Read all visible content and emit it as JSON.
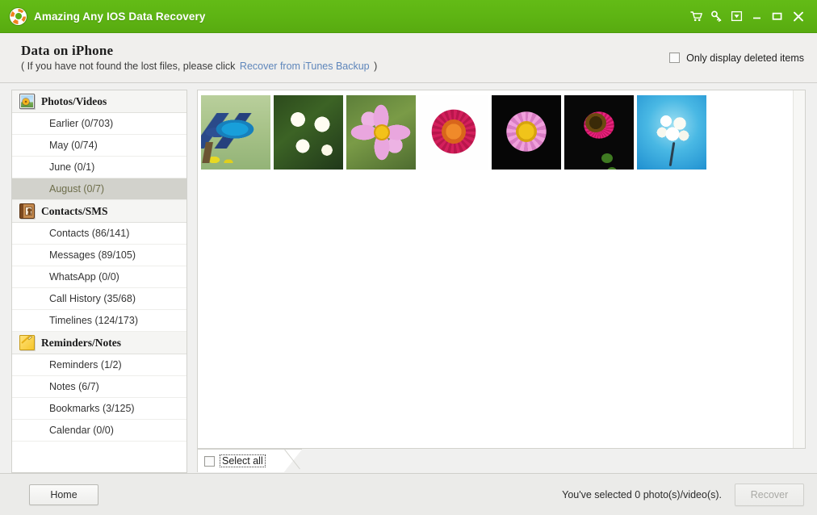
{
  "titlebar": {
    "app_title": "Amazing Any IOS Data Recovery",
    "logo_icon": "lifebuoy-icon",
    "controls": [
      {
        "name": "cart-icon",
        "label": "Buy"
      },
      {
        "name": "key-icon",
        "label": "Register"
      },
      {
        "name": "menu-box-icon",
        "label": "Menu"
      },
      {
        "name": "minimize-icon",
        "label": "Minimize"
      },
      {
        "name": "maximize-icon",
        "label": "Maximize"
      },
      {
        "name": "close-icon",
        "label": "Close"
      }
    ],
    "bg_color": "#5eb413"
  },
  "subheader": {
    "page_title": "Data on iPhone",
    "note_prefix": "( If you have not found the lost files, please click",
    "link_text": "Recover from iTunes Backup",
    "note_suffix": ")",
    "link_color": "#5e86bb",
    "deleted_filter_label": "Only display deleted items",
    "deleted_filter_checked": false
  },
  "sidebar": {
    "groups": [
      {
        "title": "Photos/Videos",
        "icon": "photos-icon",
        "items": [
          {
            "label": "Earlier (0/703)",
            "selected": false
          },
          {
            "label": "May (0/74)",
            "selected": false
          },
          {
            "label": "June (0/1)",
            "selected": false
          },
          {
            "label": "August (0/7)",
            "selected": true
          }
        ]
      },
      {
        "title": "Contacts/SMS",
        "icon": "contacts-book-icon",
        "items": [
          {
            "label": "Contacts (86/141)",
            "selected": false
          },
          {
            "label": "Messages (89/105)",
            "selected": false
          },
          {
            "label": "WhatsApp (0/0)",
            "selected": false
          },
          {
            "label": "Call History (35/68)",
            "selected": false
          },
          {
            "label": "Timelines (124/173)",
            "selected": false
          }
        ]
      },
      {
        "title": "Reminders/Notes",
        "icon": "notes-icon",
        "items": [
          {
            "label": "Reminders (1/2)",
            "selected": false
          },
          {
            "label": "Notes (6/7)",
            "selected": false
          },
          {
            "label": "Bookmarks (3/125)",
            "selected": false
          },
          {
            "label": "Calendar (0/0)",
            "selected": false
          }
        ]
      }
    ],
    "selected_highlight_color": "#d2d2cc"
  },
  "content": {
    "thumbnails": [
      {
        "name": "thumbnail-blue-bird",
        "alt": "Blue bird perched on branch"
      },
      {
        "name": "thumbnail-plumeria",
        "alt": "White and yellow plumeria flowers"
      },
      {
        "name": "thumbnail-pink-cosmos",
        "alt": "Pink cosmos flower in grass"
      },
      {
        "name": "thumbnail-crimson-daisy",
        "alt": "Crimson daisy on white background"
      },
      {
        "name": "thumbnail-pink-dahlia",
        "alt": "Pink dahlia on black background"
      },
      {
        "name": "thumbnail-magenta-gerbera",
        "alt": "Magenta gerbera on black background"
      },
      {
        "name": "thumbnail-white-flower-sky",
        "alt": "White flower against blue sky"
      }
    ],
    "select_all_label": "Select all",
    "select_all_checked": false
  },
  "footer": {
    "home_label": "Home",
    "status_text": "You've selected 0 photo(s)/video(s).",
    "recover_label": "Recover",
    "recover_enabled": false
  }
}
